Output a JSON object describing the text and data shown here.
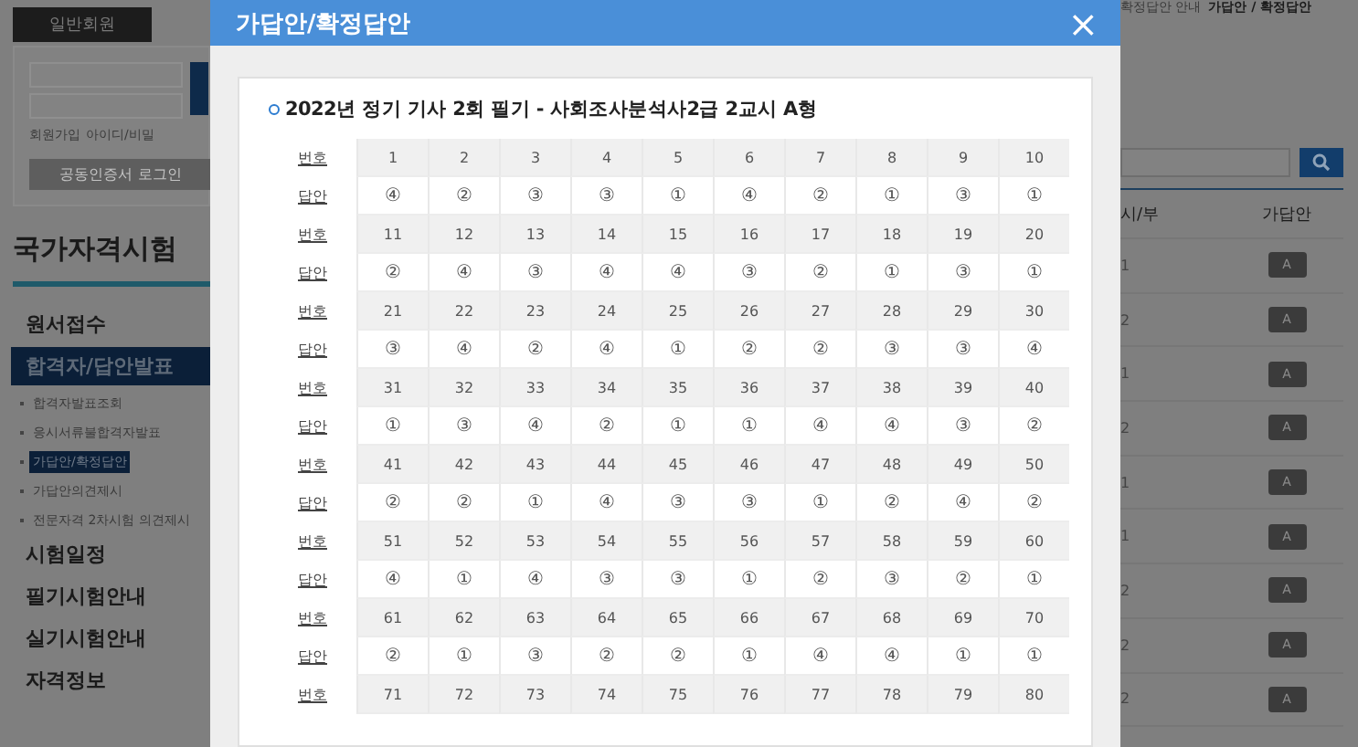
{
  "sidebar": {
    "member_tab": "일반회원",
    "signup_link": "회원가입",
    "find_link": "아이디/비밀",
    "cert_login_button": "공동인증서 로그인",
    "heading": "국가자격시험",
    "menu": [
      {
        "label": "원서접수",
        "selected": false
      },
      {
        "label": "합격자/답안발표",
        "selected": true,
        "children": [
          {
            "label": "합격자발표조회",
            "selected": false
          },
          {
            "label": "응시서류불합격자발표",
            "selected": false
          },
          {
            "label": "가답안/확정답안",
            "selected": true
          },
          {
            "label": "가답안의견제시",
            "selected": false
          },
          {
            "label": "전문자격 2차시험 의견제시",
            "selected": false
          }
        ]
      },
      {
        "label": "시험일정",
        "selected": false
      },
      {
        "label": "필기시험안내",
        "selected": false
      },
      {
        "label": "실기시험안내",
        "selected": false
      },
      {
        "label": "자격정보",
        "selected": false
      }
    ]
  },
  "modal": {
    "title": "가답안/확정답안",
    "close": "×",
    "exam_title": "2022년 정기 기사 2회 필기 - 사회조사분석사2급 2교시 A형",
    "rows": [
      {
        "kind": "number",
        "label": "번호",
        "cells": [
          "1",
          "2",
          "3",
          "4",
          "5",
          "6",
          "7",
          "8",
          "9",
          "10"
        ]
      },
      {
        "kind": "answer",
        "label": "답안",
        "cells": [
          "④",
          "②",
          "③",
          "③",
          "①",
          "④",
          "②",
          "①",
          "③",
          "①"
        ]
      },
      {
        "kind": "number",
        "label": "번호",
        "cells": [
          "11",
          "12",
          "13",
          "14",
          "15",
          "16",
          "17",
          "18",
          "19",
          "20"
        ]
      },
      {
        "kind": "answer",
        "label": "답안",
        "cells": [
          "②",
          "④",
          "③",
          "④",
          "④",
          "③",
          "②",
          "①",
          "③",
          "①"
        ]
      },
      {
        "kind": "number",
        "label": "번호",
        "cells": [
          "21",
          "22",
          "23",
          "24",
          "25",
          "26",
          "27",
          "28",
          "29",
          "30"
        ]
      },
      {
        "kind": "answer",
        "label": "답안",
        "cells": [
          "③",
          "④",
          "②",
          "④",
          "①",
          "②",
          "②",
          "③",
          "③",
          "④"
        ]
      },
      {
        "kind": "number",
        "label": "번호",
        "cells": [
          "31",
          "32",
          "33",
          "34",
          "35",
          "36",
          "37",
          "38",
          "39",
          "40"
        ]
      },
      {
        "kind": "answer",
        "label": "답안",
        "cells": [
          "①",
          "③",
          "④",
          "②",
          "①",
          "①",
          "④",
          "④",
          "③",
          "②"
        ]
      },
      {
        "kind": "number",
        "label": "번호",
        "cells": [
          "41",
          "42",
          "43",
          "44",
          "45",
          "46",
          "47",
          "48",
          "49",
          "50"
        ]
      },
      {
        "kind": "answer",
        "label": "답안",
        "cells": [
          "②",
          "②",
          "①",
          "④",
          "③",
          "③",
          "①",
          "②",
          "④",
          "②"
        ]
      },
      {
        "kind": "number",
        "label": "번호",
        "cells": [
          "51",
          "52",
          "53",
          "54",
          "55",
          "56",
          "57",
          "58",
          "59",
          "60"
        ]
      },
      {
        "kind": "answer",
        "label": "답안",
        "cells": [
          "④",
          "①",
          "④",
          "③",
          "③",
          "①",
          "②",
          "③",
          "②",
          "①"
        ]
      },
      {
        "kind": "number",
        "label": "번호",
        "cells": [
          "61",
          "62",
          "63",
          "64",
          "65",
          "66",
          "67",
          "68",
          "69",
          "70"
        ]
      },
      {
        "kind": "answer",
        "label": "답안",
        "cells": [
          "②",
          "①",
          "③",
          "②",
          "②",
          "①",
          "④",
          "④",
          "①",
          "①"
        ]
      },
      {
        "kind": "number",
        "label": "번호",
        "cells": [
          "71",
          "72",
          "73",
          "74",
          "75",
          "76",
          "77",
          "78",
          "79",
          "80"
        ]
      }
    ]
  },
  "right": {
    "breadcrumb": [
      "확정답안 안내",
      "가답안 / 확정답안"
    ],
    "columns": [
      "시/부",
      "가답안"
    ],
    "rows": [
      {
        "session": "1",
        "answer": "A"
      },
      {
        "session": "2",
        "answer": "A"
      },
      {
        "session": "1",
        "answer": "A"
      },
      {
        "session": "2",
        "answer": "A"
      },
      {
        "session": "1",
        "answer": "A"
      },
      {
        "session": "1",
        "answer": "A"
      },
      {
        "session": "2",
        "answer": "A"
      },
      {
        "session": "2",
        "answer": "A"
      },
      {
        "session": "2",
        "answer": "A"
      }
    ]
  }
}
